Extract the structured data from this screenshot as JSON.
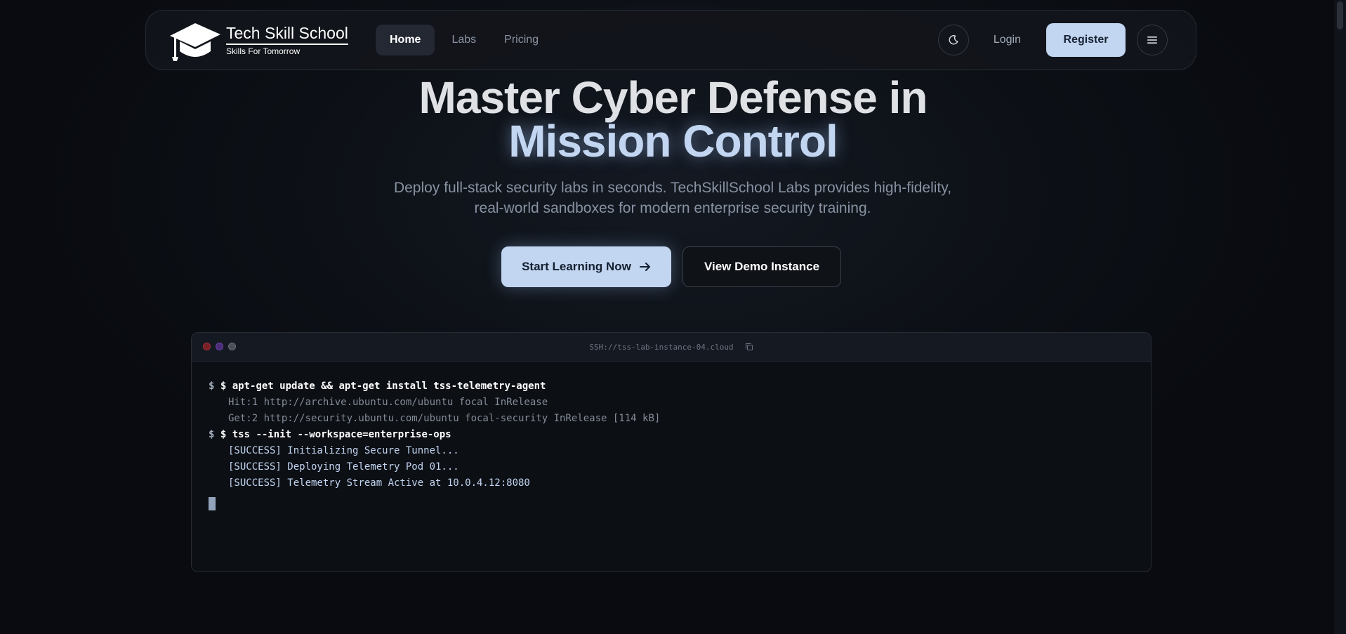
{
  "nav": {
    "brand_title": "Tech Skill School",
    "brand_subtitle": "Skills For Tomorrow",
    "links": [
      {
        "label": "Home",
        "active": true
      },
      {
        "label": "Labs",
        "active": false
      },
      {
        "label": "Pricing",
        "active": false
      }
    ],
    "theme_toggle_icon": "moon-icon",
    "login_label": "Login",
    "register_label": "Register",
    "menu_icon": "hamburger-menu-icon"
  },
  "hero": {
    "title_line1": "Master Cyber Defense in",
    "title_line2": "Mission Control",
    "subtitle": "Deploy full-stack security labs in seconds. TechSkillSchool Labs provides high-fidelity, real-world sandboxes for modern enterprise security training.",
    "primary_cta": "Start Learning Now",
    "primary_cta_icon": "arrow-right-icon",
    "secondary_cta": "View Demo Instance"
  },
  "terminal": {
    "title": "SSH://tss-lab-instance-04.cloud",
    "copy_icon": "copy-icon",
    "lines": [
      {
        "type": "command",
        "prompt": "$",
        "text": "$ apt-get update && apt-get install tss-telemetry-agent"
      },
      {
        "type": "output",
        "text": "Hit:1 http://archive.ubuntu.com/ubuntu focal InRelease"
      },
      {
        "type": "output",
        "text": "Get:2 http://security.ubuntu.com/ubuntu focal-security InRelease [114 kB]"
      },
      {
        "type": "command",
        "prompt": "$",
        "text": "$ tss --init --workspace=enterprise-ops"
      },
      {
        "type": "success",
        "text": "[SUCCESS] Initializing Secure Tunnel..."
      },
      {
        "type": "success",
        "text": "[SUCCESS] Deploying Telemetry Pod 01..."
      },
      {
        "type": "success",
        "text": "[SUCCESS] Telemetry Stream Active at 10.0.4.12:8080"
      }
    ]
  },
  "colors": {
    "accent": "#c2d5f1",
    "background": "#0d1117",
    "terminal_red": "#7a1f25",
    "terminal_purple": "#4b2c78",
    "terminal_gray": "#4a4f58"
  }
}
